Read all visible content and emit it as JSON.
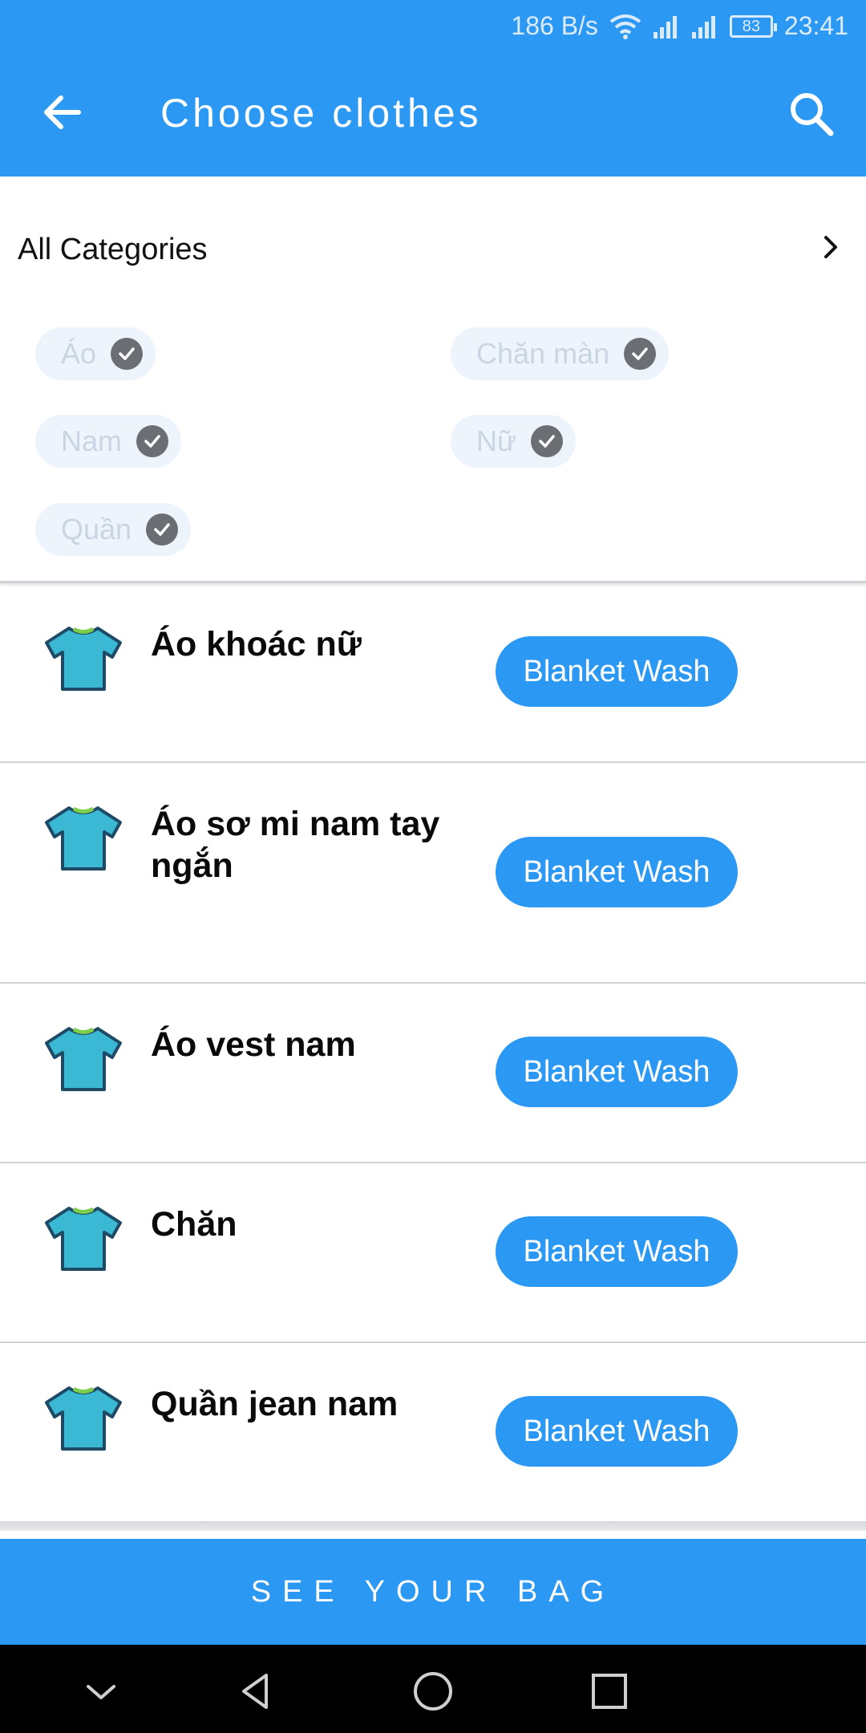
{
  "status_bar": {
    "net_speed": "186 B/s",
    "battery": "83",
    "time": "23:41"
  },
  "header": {
    "title": "Choose clothes"
  },
  "categories": {
    "label": "All Categories",
    "chips": [
      {
        "label": "Áo"
      },
      {
        "label": "Chăn màn"
      },
      {
        "label": "Nam"
      },
      {
        "label": "Nữ"
      },
      {
        "label": "Quần"
      }
    ]
  },
  "items": [
    {
      "name": "Áo khoác nữ",
      "button": "Blanket Wash"
    },
    {
      "name": "Áo sơ mi nam tay ngắn",
      "button": "Blanket Wash"
    },
    {
      "name": "Áo vest nam",
      "button": "Blanket Wash"
    },
    {
      "name": "Chăn",
      "button": "Blanket Wash"
    },
    {
      "name": "Quần jean nam",
      "button": "Blanket Wash"
    }
  ],
  "footer": {
    "bag_label": "SEE YOUR BAG"
  },
  "colors": {
    "accent": "#2b98f4",
    "shirt": "#3bb8d4",
    "shirt_outline": "#1f4a66",
    "collar": "#7ccf4a"
  }
}
